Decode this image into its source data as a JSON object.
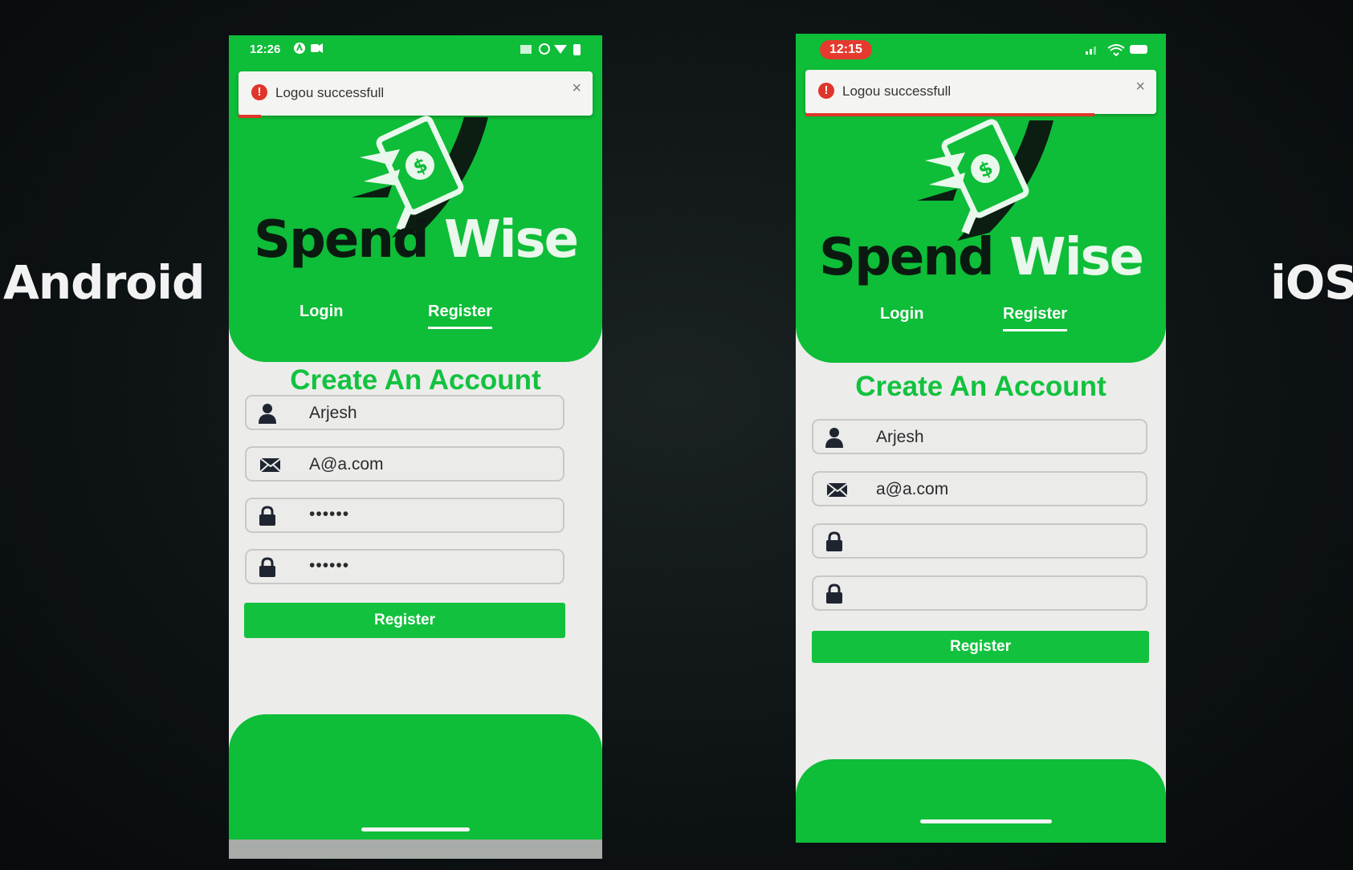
{
  "labels": {
    "left": "Android",
    "right": "iOS"
  },
  "colors": {
    "brand_green": "#0ebd38",
    "error_red": "#e0352b",
    "field_bg": "#ebebea"
  },
  "android": {
    "status_time": "12:26",
    "toast": {
      "message": "Logou successfull",
      "close": "×"
    },
    "brand": {
      "word1": "Spend",
      "word2": "Wise"
    },
    "tabs": {
      "login": "Login",
      "register": "Register",
      "active": "Register"
    },
    "form": {
      "title": "Create An Account",
      "name": "Arjesh",
      "email": "A@a.com",
      "password": "••••••",
      "confirm_password": "••••••",
      "submit": "Register"
    }
  },
  "ios": {
    "status_time": "12:15",
    "toast": {
      "message": "Logou successfull",
      "close": "×"
    },
    "brand": {
      "word1": "Spend",
      "word2": "Wise"
    },
    "tabs": {
      "login": "Login",
      "register": "Register",
      "active": "Register"
    },
    "form": {
      "title": "Create An Account",
      "name": "Arjesh",
      "email": "a@a.com",
      "password": "",
      "confirm_password": "",
      "submit": "Register"
    }
  }
}
